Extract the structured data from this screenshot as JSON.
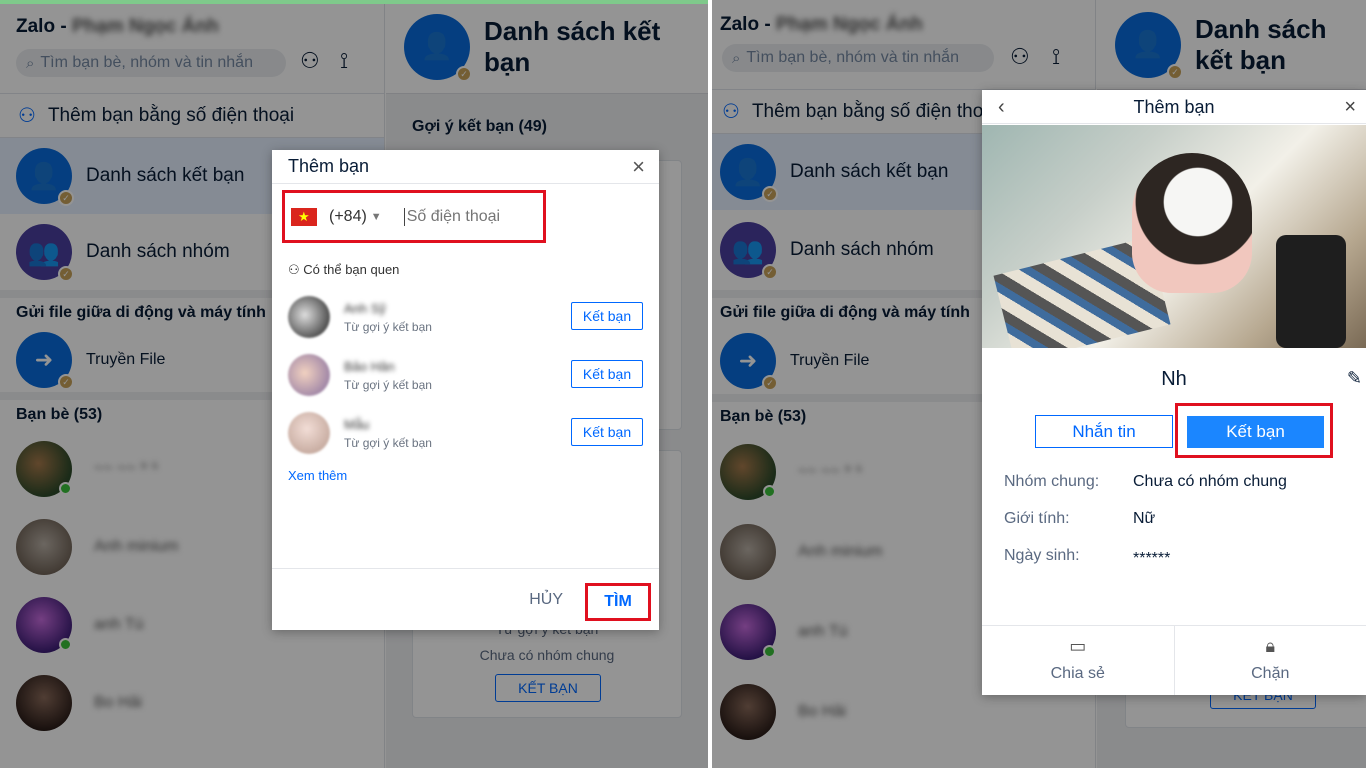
{
  "app": {
    "title": "Zalo - ",
    "account": "Phạm Ngọc Ánh"
  },
  "search": {
    "placeholder": "Tìm bạn bè, nhóm và tin nhắn"
  },
  "sidebar": {
    "add_by_phone": "Thêm bạn bằng số điện thoại",
    "items": [
      {
        "label": "Danh sách kết bạn"
      },
      {
        "label": "Danh sách nhóm"
      }
    ],
    "file_section": "Gửi file giữa di động và máy tính",
    "file_item": "Truyền File",
    "friends_section": "Bạn bè (53)",
    "friends": [
      "~~ ~~ ⁹ ⁵",
      "Anh minium",
      "anh Tú",
      "Bo Hải"
    ]
  },
  "main": {
    "title": "Danh sách kết bạn",
    "suggestions": "Gợi ý kết bạn (49)",
    "card": {
      "from": "Từ gợi ý kết bạn",
      "groups": "Chưa có nhóm chung",
      "button": "KẾT BẠN"
    }
  },
  "dialog_add": {
    "title": "Thêm bạn",
    "country_code": "(+84)",
    "phone_placeholder": "Số điện thoại",
    "maybe_know": "Có thể bạn quen",
    "suggestions": [
      {
        "name": "Anh Sỹ",
        "source": "Từ gợi ý kết bạn",
        "button": "Kết bạn"
      },
      {
        "name": "Bảo Hân",
        "source": "Từ gợi ý kết bạn",
        "button": "Kết bạn"
      },
      {
        "name": "Mẫu",
        "source": "Từ gợi ý kết bạn",
        "button": "Kết bạn"
      }
    ],
    "see_more": "Xem thêm",
    "cancel": "HỦY",
    "find": "TÌM"
  },
  "dialog_profile": {
    "title": "Thêm bạn",
    "name": "Nh",
    "message_button": "Nhắn tin",
    "add_button": "Kết bạn",
    "info": [
      {
        "label": "Nhóm chung:",
        "value": "Chưa có nhóm chung"
      },
      {
        "label": "Giới tính:",
        "value": "Nữ"
      },
      {
        "label": "Ngày sinh:",
        "value": "******"
      }
    ],
    "share": "Chia sẻ",
    "block": "Chặn"
  },
  "colors": {
    "accent": "#0068ff",
    "highlight": "#e0101f"
  }
}
